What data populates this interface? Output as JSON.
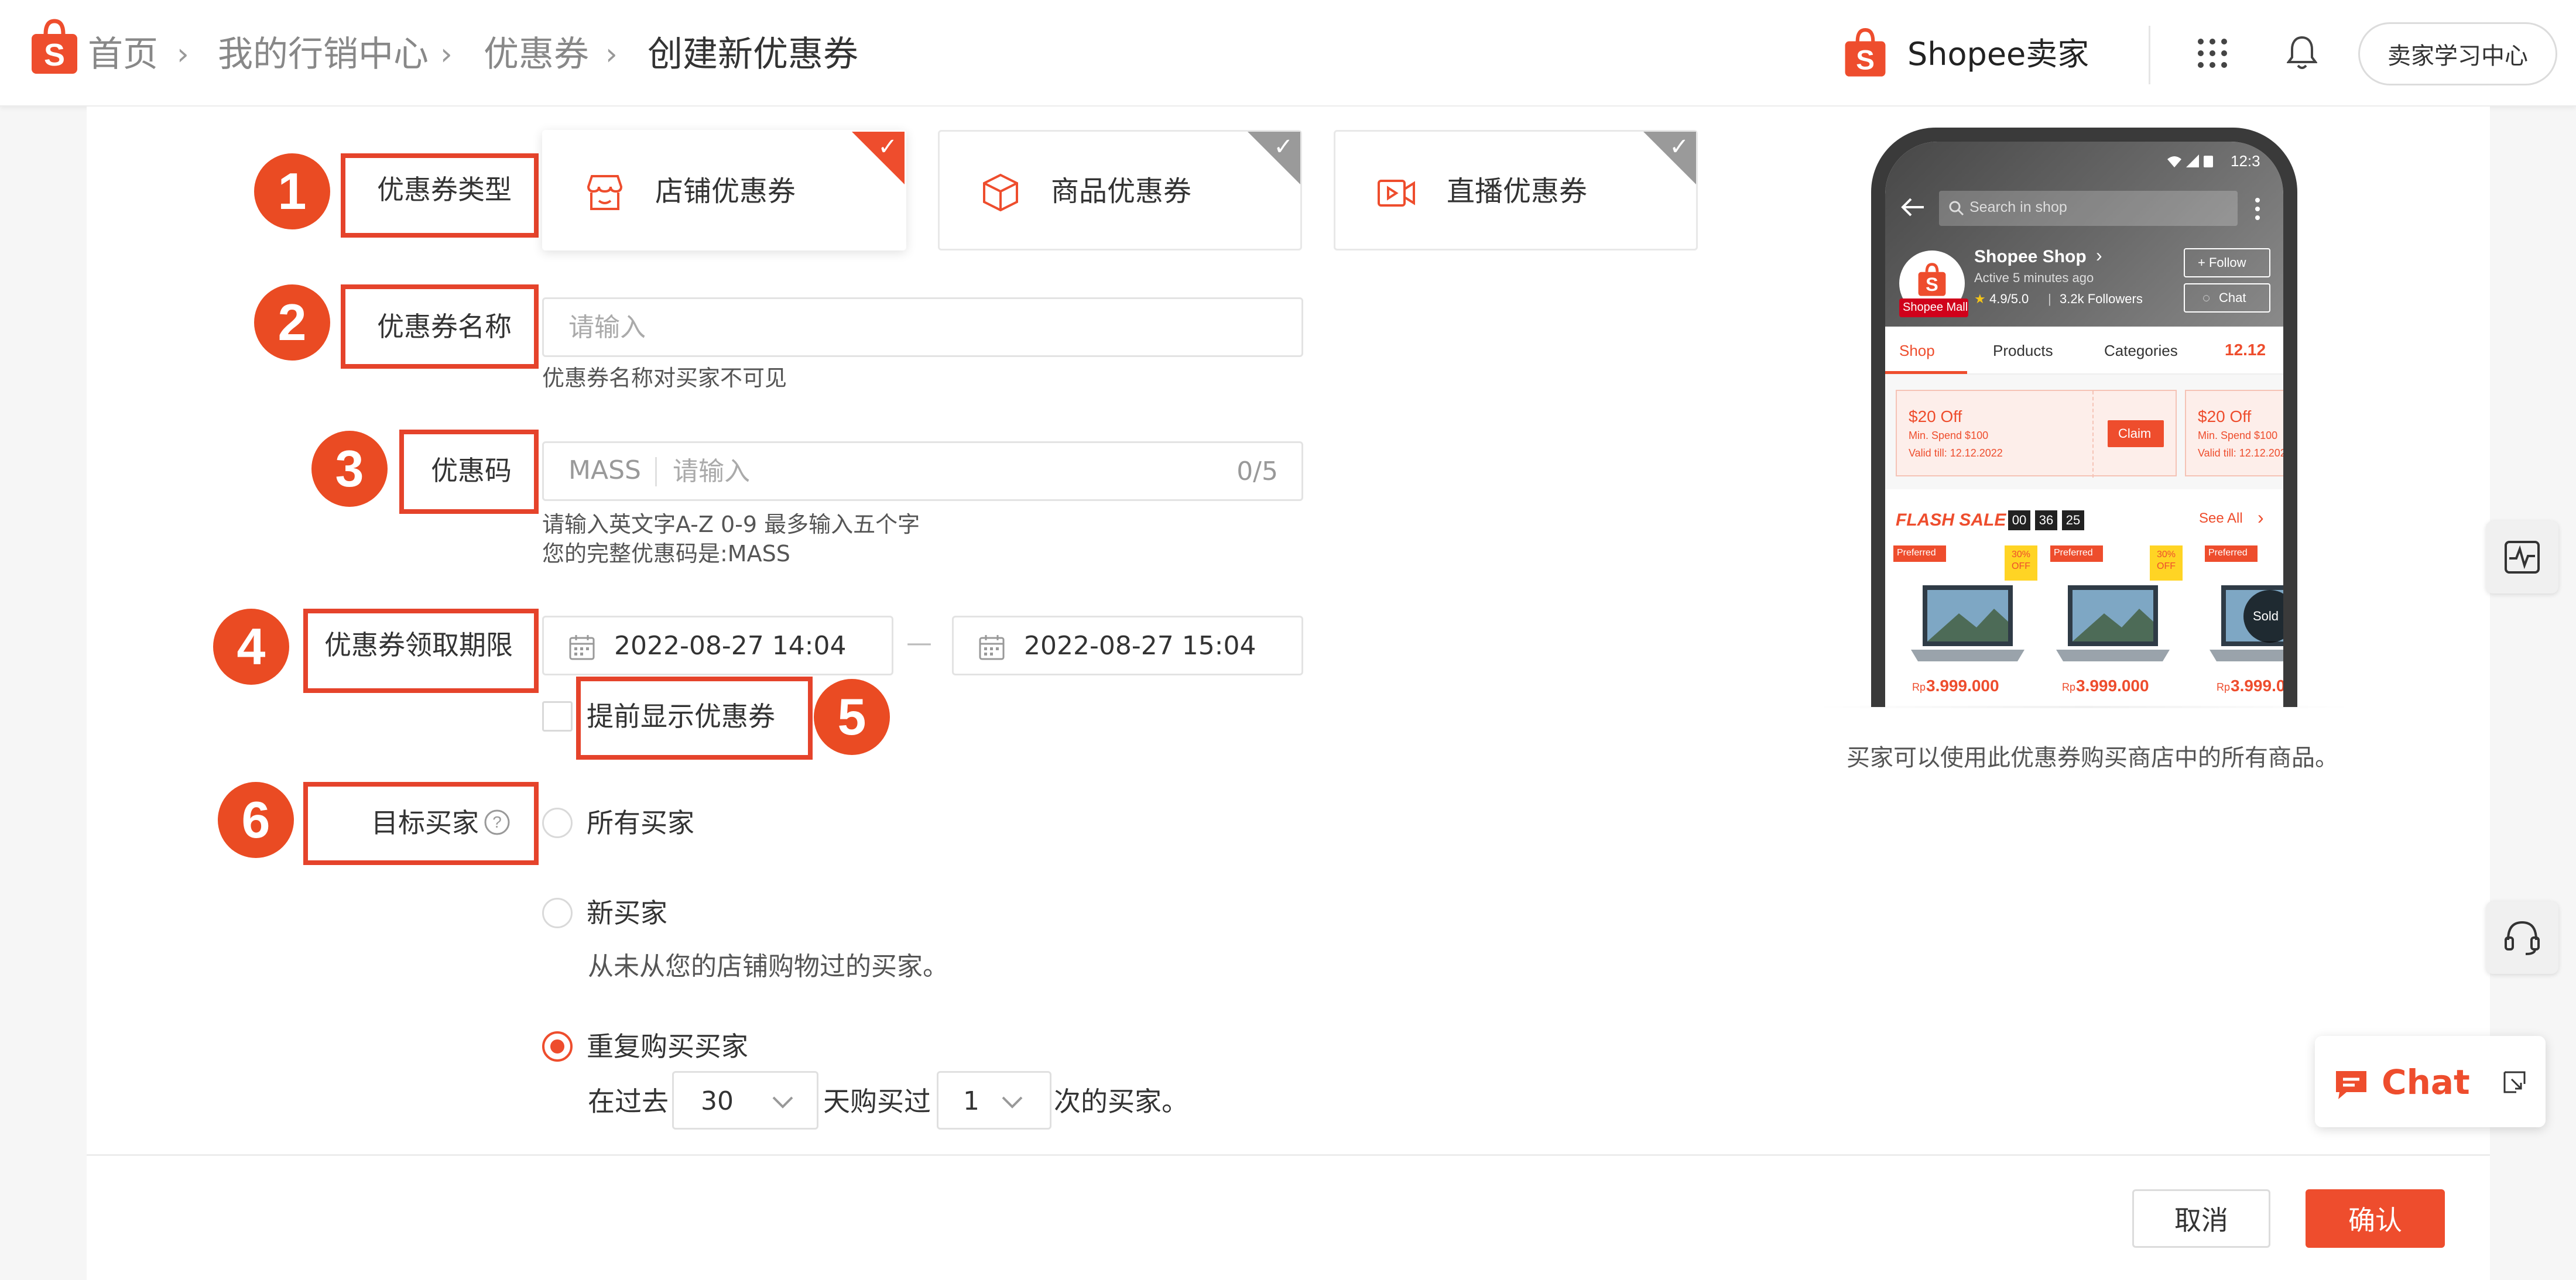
{
  "breadcrumb": {
    "home": "首页",
    "marketing": "我的行销中心",
    "vouchers": "优惠券",
    "current": "创建新优惠券"
  },
  "header": {
    "brand": "Shopee卖家",
    "learn_center": "卖家学习中心"
  },
  "steps": [
    "1",
    "2",
    "3",
    "4",
    "5",
    "6"
  ],
  "form": {
    "voucher_type_label": "优惠券类型",
    "voucher_types": [
      {
        "label": "店铺优惠券",
        "icon": "shop-icon",
        "selected": true
      },
      {
        "label": "商品优惠券",
        "icon": "box-icon",
        "selected": false
      },
      {
        "label": "直播优惠券",
        "icon": "live-video-icon",
        "selected": false
      }
    ],
    "name_label": "优惠券名称",
    "name_placeholder": "请输入",
    "name_hint": "优惠券名称对买家不可见",
    "code_label": "优惠码",
    "code_prefix": "MASS",
    "code_placeholder": "请输入",
    "code_counter": "0/5",
    "code_hint1": "请输入英文字A-Z 0-9 最多输入五个字",
    "code_hint2": "您的完整优惠码是:MASS",
    "period_label": "优惠券领取期限",
    "start_date": "2022-08-27 14:04",
    "end_date": "2022-08-27 15:04",
    "date_separator": "—",
    "show_early_label": "提前显示优惠券",
    "target_label": "目标买家",
    "target_options": [
      {
        "label": "所有买家",
        "checked": false
      },
      {
        "label": "新买家",
        "checked": false,
        "desc": "从未从您的店铺购物过的买家。"
      },
      {
        "label": "重复购买买家",
        "checked": true
      }
    ],
    "repeat_prefix": "在过去",
    "repeat_days": "30",
    "repeat_mid": "天购买过",
    "repeat_times": "1",
    "repeat_suffix": "次的买家。"
  },
  "preview": {
    "time": "12:3",
    "search_placeholder": "Search in shop",
    "shop_name": "Shopee Shop",
    "active": "Active 5 minutes ago",
    "rating": "4.9/5.0",
    "followers": "3.2k Followers",
    "mall_badge": "Shopee Mall",
    "follow_btn": "+ Follow",
    "chat_btn": "Chat",
    "tabs": [
      "Shop",
      "Products",
      "Categories",
      "12.12"
    ],
    "voucher_title": "$20 Off",
    "voucher_min": "Min. Spend $100",
    "voucher_valid": "Valid till: 12.12.2022",
    "claim": "Claim",
    "flash_sale": "FLASH SALE",
    "timer": [
      "00",
      "36",
      "25"
    ],
    "see_all": "See All",
    "preferred": "Preferred",
    "off_badge": "30% OFF",
    "sold_out": "Sold",
    "currency": "Rp",
    "price": "3.999.000",
    "caption": "买家可以使用此优惠券购买商店中的所有商品。"
  },
  "chat": {
    "label": "Chat"
  },
  "actions": {
    "cancel": "取消",
    "confirm": "确认"
  },
  "colors": {
    "accent": "#ee4d2d",
    "marker": "#ea4b23"
  }
}
